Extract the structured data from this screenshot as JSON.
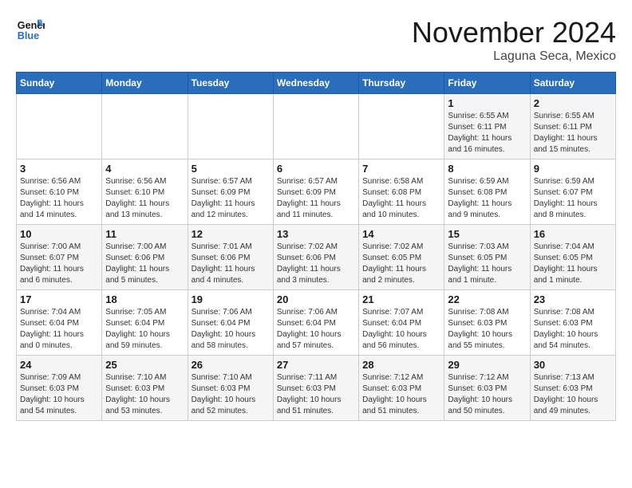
{
  "logo": {
    "line1": "General",
    "line2": "Blue"
  },
  "header": {
    "month": "November 2024",
    "location": "Laguna Seca, Mexico"
  },
  "weekdays": [
    "Sunday",
    "Monday",
    "Tuesday",
    "Wednesday",
    "Thursday",
    "Friday",
    "Saturday"
  ],
  "weeks": [
    [
      {
        "day": "",
        "info": ""
      },
      {
        "day": "",
        "info": ""
      },
      {
        "day": "",
        "info": ""
      },
      {
        "day": "",
        "info": ""
      },
      {
        "day": "",
        "info": ""
      },
      {
        "day": "1",
        "info": "Sunrise: 6:55 AM\nSunset: 6:11 PM\nDaylight: 11 hours\nand 16 minutes."
      },
      {
        "day": "2",
        "info": "Sunrise: 6:55 AM\nSunset: 6:11 PM\nDaylight: 11 hours\nand 15 minutes."
      }
    ],
    [
      {
        "day": "3",
        "info": "Sunrise: 6:56 AM\nSunset: 6:10 PM\nDaylight: 11 hours\nand 14 minutes."
      },
      {
        "day": "4",
        "info": "Sunrise: 6:56 AM\nSunset: 6:10 PM\nDaylight: 11 hours\nand 13 minutes."
      },
      {
        "day": "5",
        "info": "Sunrise: 6:57 AM\nSunset: 6:09 PM\nDaylight: 11 hours\nand 12 minutes."
      },
      {
        "day": "6",
        "info": "Sunrise: 6:57 AM\nSunset: 6:09 PM\nDaylight: 11 hours\nand 11 minutes."
      },
      {
        "day": "7",
        "info": "Sunrise: 6:58 AM\nSunset: 6:08 PM\nDaylight: 11 hours\nand 10 minutes."
      },
      {
        "day": "8",
        "info": "Sunrise: 6:59 AM\nSunset: 6:08 PM\nDaylight: 11 hours\nand 9 minutes."
      },
      {
        "day": "9",
        "info": "Sunrise: 6:59 AM\nSunset: 6:07 PM\nDaylight: 11 hours\nand 8 minutes."
      }
    ],
    [
      {
        "day": "10",
        "info": "Sunrise: 7:00 AM\nSunset: 6:07 PM\nDaylight: 11 hours\nand 6 minutes."
      },
      {
        "day": "11",
        "info": "Sunrise: 7:00 AM\nSunset: 6:06 PM\nDaylight: 11 hours\nand 5 minutes."
      },
      {
        "day": "12",
        "info": "Sunrise: 7:01 AM\nSunset: 6:06 PM\nDaylight: 11 hours\nand 4 minutes."
      },
      {
        "day": "13",
        "info": "Sunrise: 7:02 AM\nSunset: 6:06 PM\nDaylight: 11 hours\nand 3 minutes."
      },
      {
        "day": "14",
        "info": "Sunrise: 7:02 AM\nSunset: 6:05 PM\nDaylight: 11 hours\nand 2 minutes."
      },
      {
        "day": "15",
        "info": "Sunrise: 7:03 AM\nSunset: 6:05 PM\nDaylight: 11 hours\nand 1 minute."
      },
      {
        "day": "16",
        "info": "Sunrise: 7:04 AM\nSunset: 6:05 PM\nDaylight: 11 hours\nand 1 minute."
      }
    ],
    [
      {
        "day": "17",
        "info": "Sunrise: 7:04 AM\nSunset: 6:04 PM\nDaylight: 11 hours\nand 0 minutes."
      },
      {
        "day": "18",
        "info": "Sunrise: 7:05 AM\nSunset: 6:04 PM\nDaylight: 10 hours\nand 59 minutes."
      },
      {
        "day": "19",
        "info": "Sunrise: 7:06 AM\nSunset: 6:04 PM\nDaylight: 10 hours\nand 58 minutes."
      },
      {
        "day": "20",
        "info": "Sunrise: 7:06 AM\nSunset: 6:04 PM\nDaylight: 10 hours\nand 57 minutes."
      },
      {
        "day": "21",
        "info": "Sunrise: 7:07 AM\nSunset: 6:04 PM\nDaylight: 10 hours\nand 56 minutes."
      },
      {
        "day": "22",
        "info": "Sunrise: 7:08 AM\nSunset: 6:03 PM\nDaylight: 10 hours\nand 55 minutes."
      },
      {
        "day": "23",
        "info": "Sunrise: 7:08 AM\nSunset: 6:03 PM\nDaylight: 10 hours\nand 54 minutes."
      }
    ],
    [
      {
        "day": "24",
        "info": "Sunrise: 7:09 AM\nSunset: 6:03 PM\nDaylight: 10 hours\nand 54 minutes."
      },
      {
        "day": "25",
        "info": "Sunrise: 7:10 AM\nSunset: 6:03 PM\nDaylight: 10 hours\nand 53 minutes."
      },
      {
        "day": "26",
        "info": "Sunrise: 7:10 AM\nSunset: 6:03 PM\nDaylight: 10 hours\nand 52 minutes."
      },
      {
        "day": "27",
        "info": "Sunrise: 7:11 AM\nSunset: 6:03 PM\nDaylight: 10 hours\nand 51 minutes."
      },
      {
        "day": "28",
        "info": "Sunrise: 7:12 AM\nSunset: 6:03 PM\nDaylight: 10 hours\nand 51 minutes."
      },
      {
        "day": "29",
        "info": "Sunrise: 7:12 AM\nSunset: 6:03 PM\nDaylight: 10 hours\nand 50 minutes."
      },
      {
        "day": "30",
        "info": "Sunrise: 7:13 AM\nSunset: 6:03 PM\nDaylight: 10 hours\nand 49 minutes."
      }
    ]
  ]
}
